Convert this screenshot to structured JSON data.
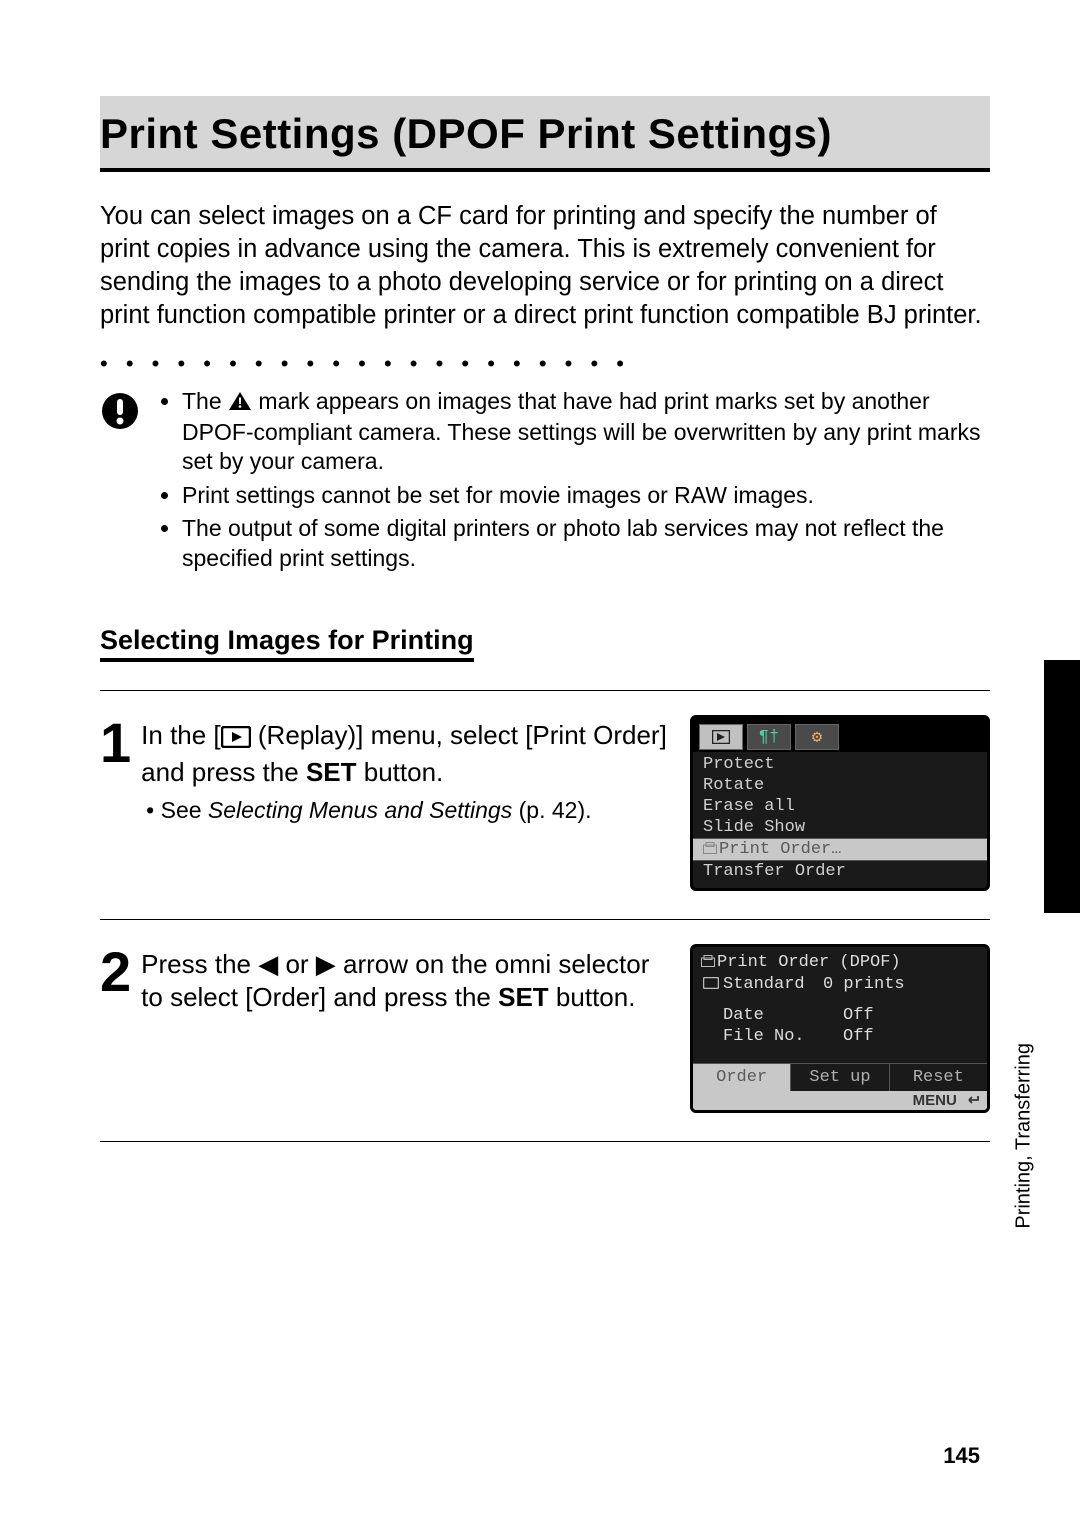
{
  "title": "Print Settings (DPOF Print Settings)",
  "intro": "You can select images on a CF card for printing and specify the number of print copies in advance using the camera. This is extremely convenient for sending the images to a photo developing service or for printing on a direct print function compatible printer or a direct print function compatible BJ printer.",
  "caution": [
    {
      "pre": "The ",
      "post": " mark appears on images that have had print marks set by another DPOF-compliant camera. These settings will be overwritten by any print marks set by your camera."
    },
    "Print settings cannot be set for movie images or RAW images.",
    "The output of some digital printers or photo lab services may not reflect the specified print settings."
  ],
  "subheading": "Selecting Images for Printing",
  "steps": {
    "1": {
      "text_pre": "In the [",
      "text_mid": " (Replay)] menu, select [Print Order] and press the ",
      "text_set": "SET",
      "text_post": " button.",
      "sub_bullet_pre": "• See ",
      "sub_bullet_italic": "Selecting Menus and Settings",
      "sub_bullet_post": " (p. 42)."
    },
    "2": {
      "text_pre": "Press the ",
      "text_mid": " or ",
      "text_mid2": " arrow on the omni selector to select [Order] and press the ",
      "text_set": "SET",
      "text_post": " button."
    }
  },
  "shot_replay": {
    "items": [
      "Protect",
      "Rotate",
      "Erase all",
      "Slide Show",
      "Print Order…",
      "Transfer Order"
    ],
    "selected_index": 4
  },
  "shot_print_order": {
    "header": "Print Order  (DPOF)",
    "row_standard_label": "Standard",
    "row_standard_value": "0 prints",
    "row_date_label": "Date",
    "row_date_value": "Off",
    "row_fileno_label": "File No.",
    "row_fileno_value": "Off",
    "buttons": [
      "Order",
      "Set up",
      "Reset"
    ],
    "selected_button_index": 0,
    "menu_label": "MENU"
  },
  "side_label": "Printing, Transferring",
  "page_number": "145"
}
